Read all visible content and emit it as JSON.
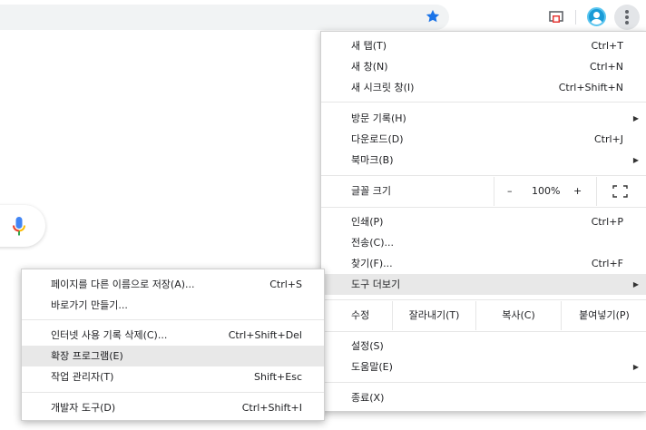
{
  "toolbar": {
    "icons": [
      "star-icon",
      "cast-icon",
      "avatar",
      "more-icon"
    ],
    "accent": "#1a73e8"
  },
  "menu": {
    "items_top": [
      {
        "label": "새 탭(T)",
        "shortcut": "Ctrl+T"
      },
      {
        "label": "새 창(N)",
        "shortcut": "Ctrl+N"
      },
      {
        "label": "새 시크릿 창(I)",
        "shortcut": "Ctrl+Shift+N"
      }
    ],
    "history": {
      "label": "방문 기록(H)"
    },
    "downloads": {
      "label": "다운로드(D)",
      "shortcut": "Ctrl+J"
    },
    "bookmarks": {
      "label": "북마크(B)"
    },
    "zoom": {
      "label": "글꼴 크기",
      "minus": "–",
      "value": "100%",
      "plus": "+"
    },
    "print": {
      "label": "인쇄(P)",
      "shortcut": "Ctrl+P"
    },
    "cast": {
      "label": "전송(C)..."
    },
    "find": {
      "label": "찾기(F)...",
      "shortcut": "Ctrl+F"
    },
    "more_tools": {
      "label": "도구 더보기"
    },
    "edit": {
      "label": "수정",
      "cut": "잘라내기(T)",
      "copy": "복사(C)",
      "paste": "붙여넣기(P)"
    },
    "settings": {
      "label": "설정(S)"
    },
    "help": {
      "label": "도움말(E)"
    },
    "exit": {
      "label": "종료(X)"
    }
  },
  "submenu": {
    "save_page": {
      "label": "페이지를 다른 이름으로 저장(A)...",
      "shortcut": "Ctrl+S"
    },
    "create_shortcut": {
      "label": "바로가기 만들기..."
    },
    "clear_data": {
      "label": "인터넷 사용 기록 삭제(C)...",
      "shortcut": "Ctrl+Shift+Del"
    },
    "extensions": {
      "label": "확장 프로그램(E)"
    },
    "task_manager": {
      "label": "작업 관리자(T)",
      "shortcut": "Shift+Esc"
    },
    "dev_tools": {
      "label": "개발자 도구(D)",
      "shortcut": "Ctrl+Shift+I"
    }
  }
}
